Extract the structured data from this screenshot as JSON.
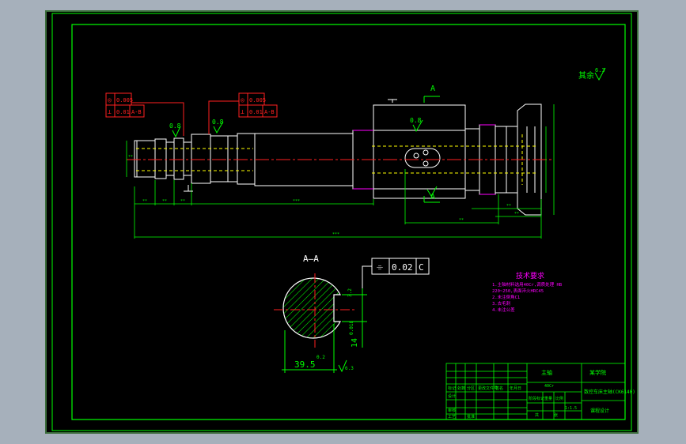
{
  "colors": {
    "background": "#a6b0bb",
    "canvas": "#000000",
    "border": "#00ff00",
    "part": "#ffffff",
    "centerline": "#ff0000",
    "hidden": "#ffff00",
    "dimension": "#00ff00",
    "annotation_box": "#ff0000",
    "notes": "#ff00ff",
    "highlight": "#ff00ff"
  },
  "roughness": {
    "general_label": "其余",
    "general_value": "6.3",
    "r1": "0.8",
    "r2": "0.8",
    "r3": "0.8",
    "r4": "0.8",
    "r5": "6.3"
  },
  "tolerance_frames": [
    {
      "symbol": "◎",
      "value": "0.005",
      "symbol2": "⊥",
      "value2": "0.01",
      "datum": "A-B"
    },
    {
      "symbol": "◎",
      "value": "0.005",
      "symbol2": "⊥",
      "value2": "0.01",
      "datum": "A-B"
    }
  ],
  "section": {
    "marker": "A",
    "title": "A—A",
    "frame_symbol": "⌯",
    "frame_value": "0.02",
    "frame_datum": "C",
    "width_dim": "39.5",
    "width_tol": "0.2",
    "height_dim": "14",
    "height_tol": "0.018",
    "keyway_dim": "3.2"
  },
  "notes": {
    "title": "技术要求",
    "lines": [
      "1.主轴材料选用40Cr,调质处理 HB",
      "  220~250,表面淬火HRC45",
      "2.未注倒角C1",
      "3.去毛刺",
      "4.未注公差"
    ]
  },
  "title_block": {
    "drawing_name": "主轴",
    "material": "40Cr",
    "company": "某学院",
    "product": "数控车床主轴(CK6140)",
    "scale": "1:1.5",
    "doc_type": "课程设计",
    "col_headers": [
      "标记",
      "处数",
      "分区",
      "更改文件号",
      "签名",
      "年月日"
    ],
    "row_labels": [
      "设计",
      "审核",
      "工艺"
    ],
    "stage_label": "阶段标记",
    "weight_label": "重量",
    "ratio_label": "比例",
    "sheet_label": "共",
    "sheet_label2": "张",
    "approve_label": "批准"
  }
}
